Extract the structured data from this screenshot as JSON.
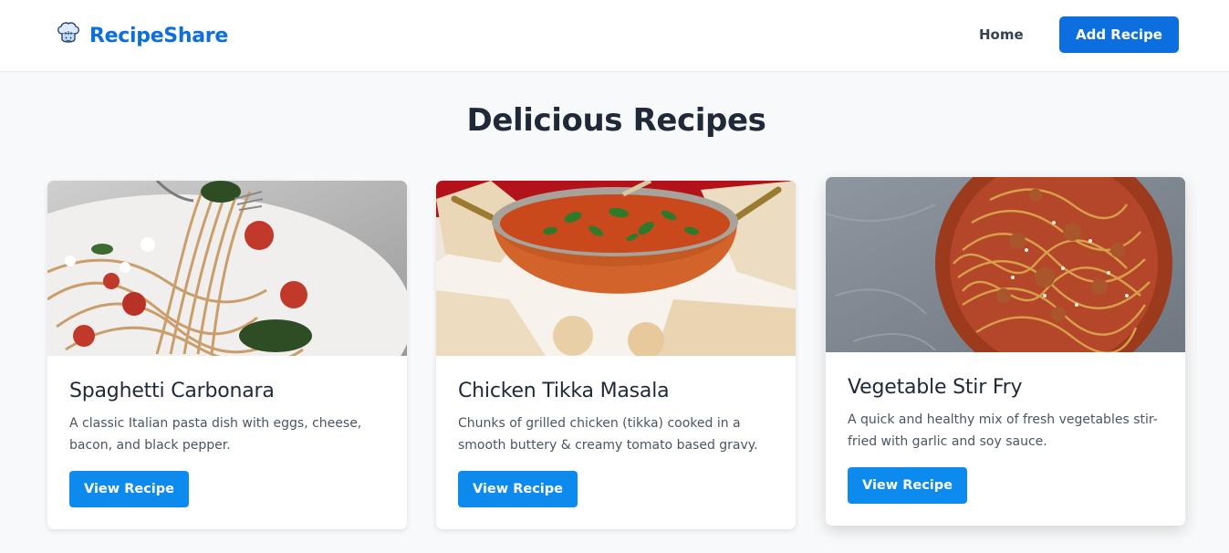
{
  "nav": {
    "brand": "RecipeShare",
    "brand_icon": "chef-hat-icon",
    "home_label": "Home",
    "add_recipe_label": "Add Recipe"
  },
  "main": {
    "title": "Delicious Recipes"
  },
  "recipes": [
    {
      "title": "Spaghetti Carbonara",
      "description": "A classic Italian pasta dish with eggs, cheese, bacon, and black pepper.",
      "button_label": "View Recipe"
    },
    {
      "title": "Chicken Tikka Masala",
      "description": "Chunks of grilled chicken (tikka) cooked in a smooth buttery & creamy tomato based gravy.",
      "button_label": "View Recipe"
    },
    {
      "title": "Vegetable Stir Fry",
      "description": "A quick and healthy mix of fresh vegetables stir-fried with garlic and soy sauce.",
      "button_label": "View Recipe"
    }
  ],
  "colors": {
    "brand": "#0d6ee0",
    "view_button": "#0d8aee",
    "background": "#f8f9fa"
  }
}
